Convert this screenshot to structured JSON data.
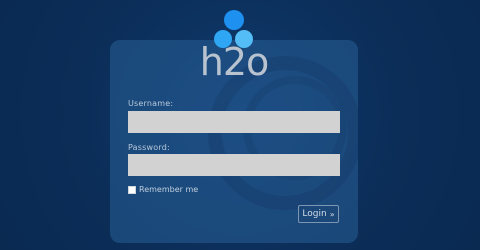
{
  "logo": {
    "text": "h2o",
    "icon": "three-circles-logo-icon",
    "colors": {
      "top_dot": "#1e90f0",
      "left_dot": "#2fa6f3",
      "right_dot": "#54bdf5",
      "text": "#b9c3cf"
    }
  },
  "form": {
    "username_label": "Username:",
    "username_value": "",
    "password_label": "Password:",
    "password_value": "",
    "remember_label": "Remember me",
    "remember_checked": false,
    "login_label": "Login",
    "login_icon": "double-chevron-right-icon"
  },
  "colors": {
    "background": "#0b2d57",
    "panel": "#285f96",
    "input_bg": "#d2d2d2",
    "label_text": "#b8c8da"
  }
}
